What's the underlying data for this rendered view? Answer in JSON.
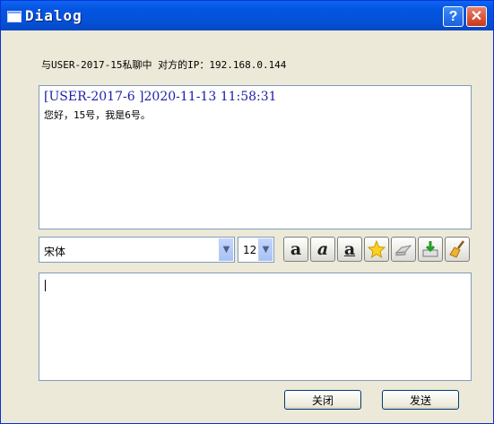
{
  "window": {
    "title": "Dialog",
    "help_label": "?",
    "close_label": "✕"
  },
  "chat": {
    "header": "与USER-2017-15私聊中 对方的IP：192.168.0.144",
    "messages": [
      {
        "header": "[USER-2017-6 ]2020-11-13 11:58:31",
        "body": "您好，15号，我是6号。"
      }
    ]
  },
  "toolbar": {
    "font_value": "宋体",
    "size_value": "12",
    "tools": [
      "bold-icon",
      "italic-icon",
      "underline-icon",
      "color-icon",
      "save-icon",
      "clear-icon",
      "broom-icon"
    ]
  },
  "input": {
    "value": ""
  },
  "buttons": {
    "close_label": "关闭",
    "send_label": "发送"
  },
  "colors": {
    "titlebar": "#0454e3",
    "message_header": "#1d21a8"
  }
}
